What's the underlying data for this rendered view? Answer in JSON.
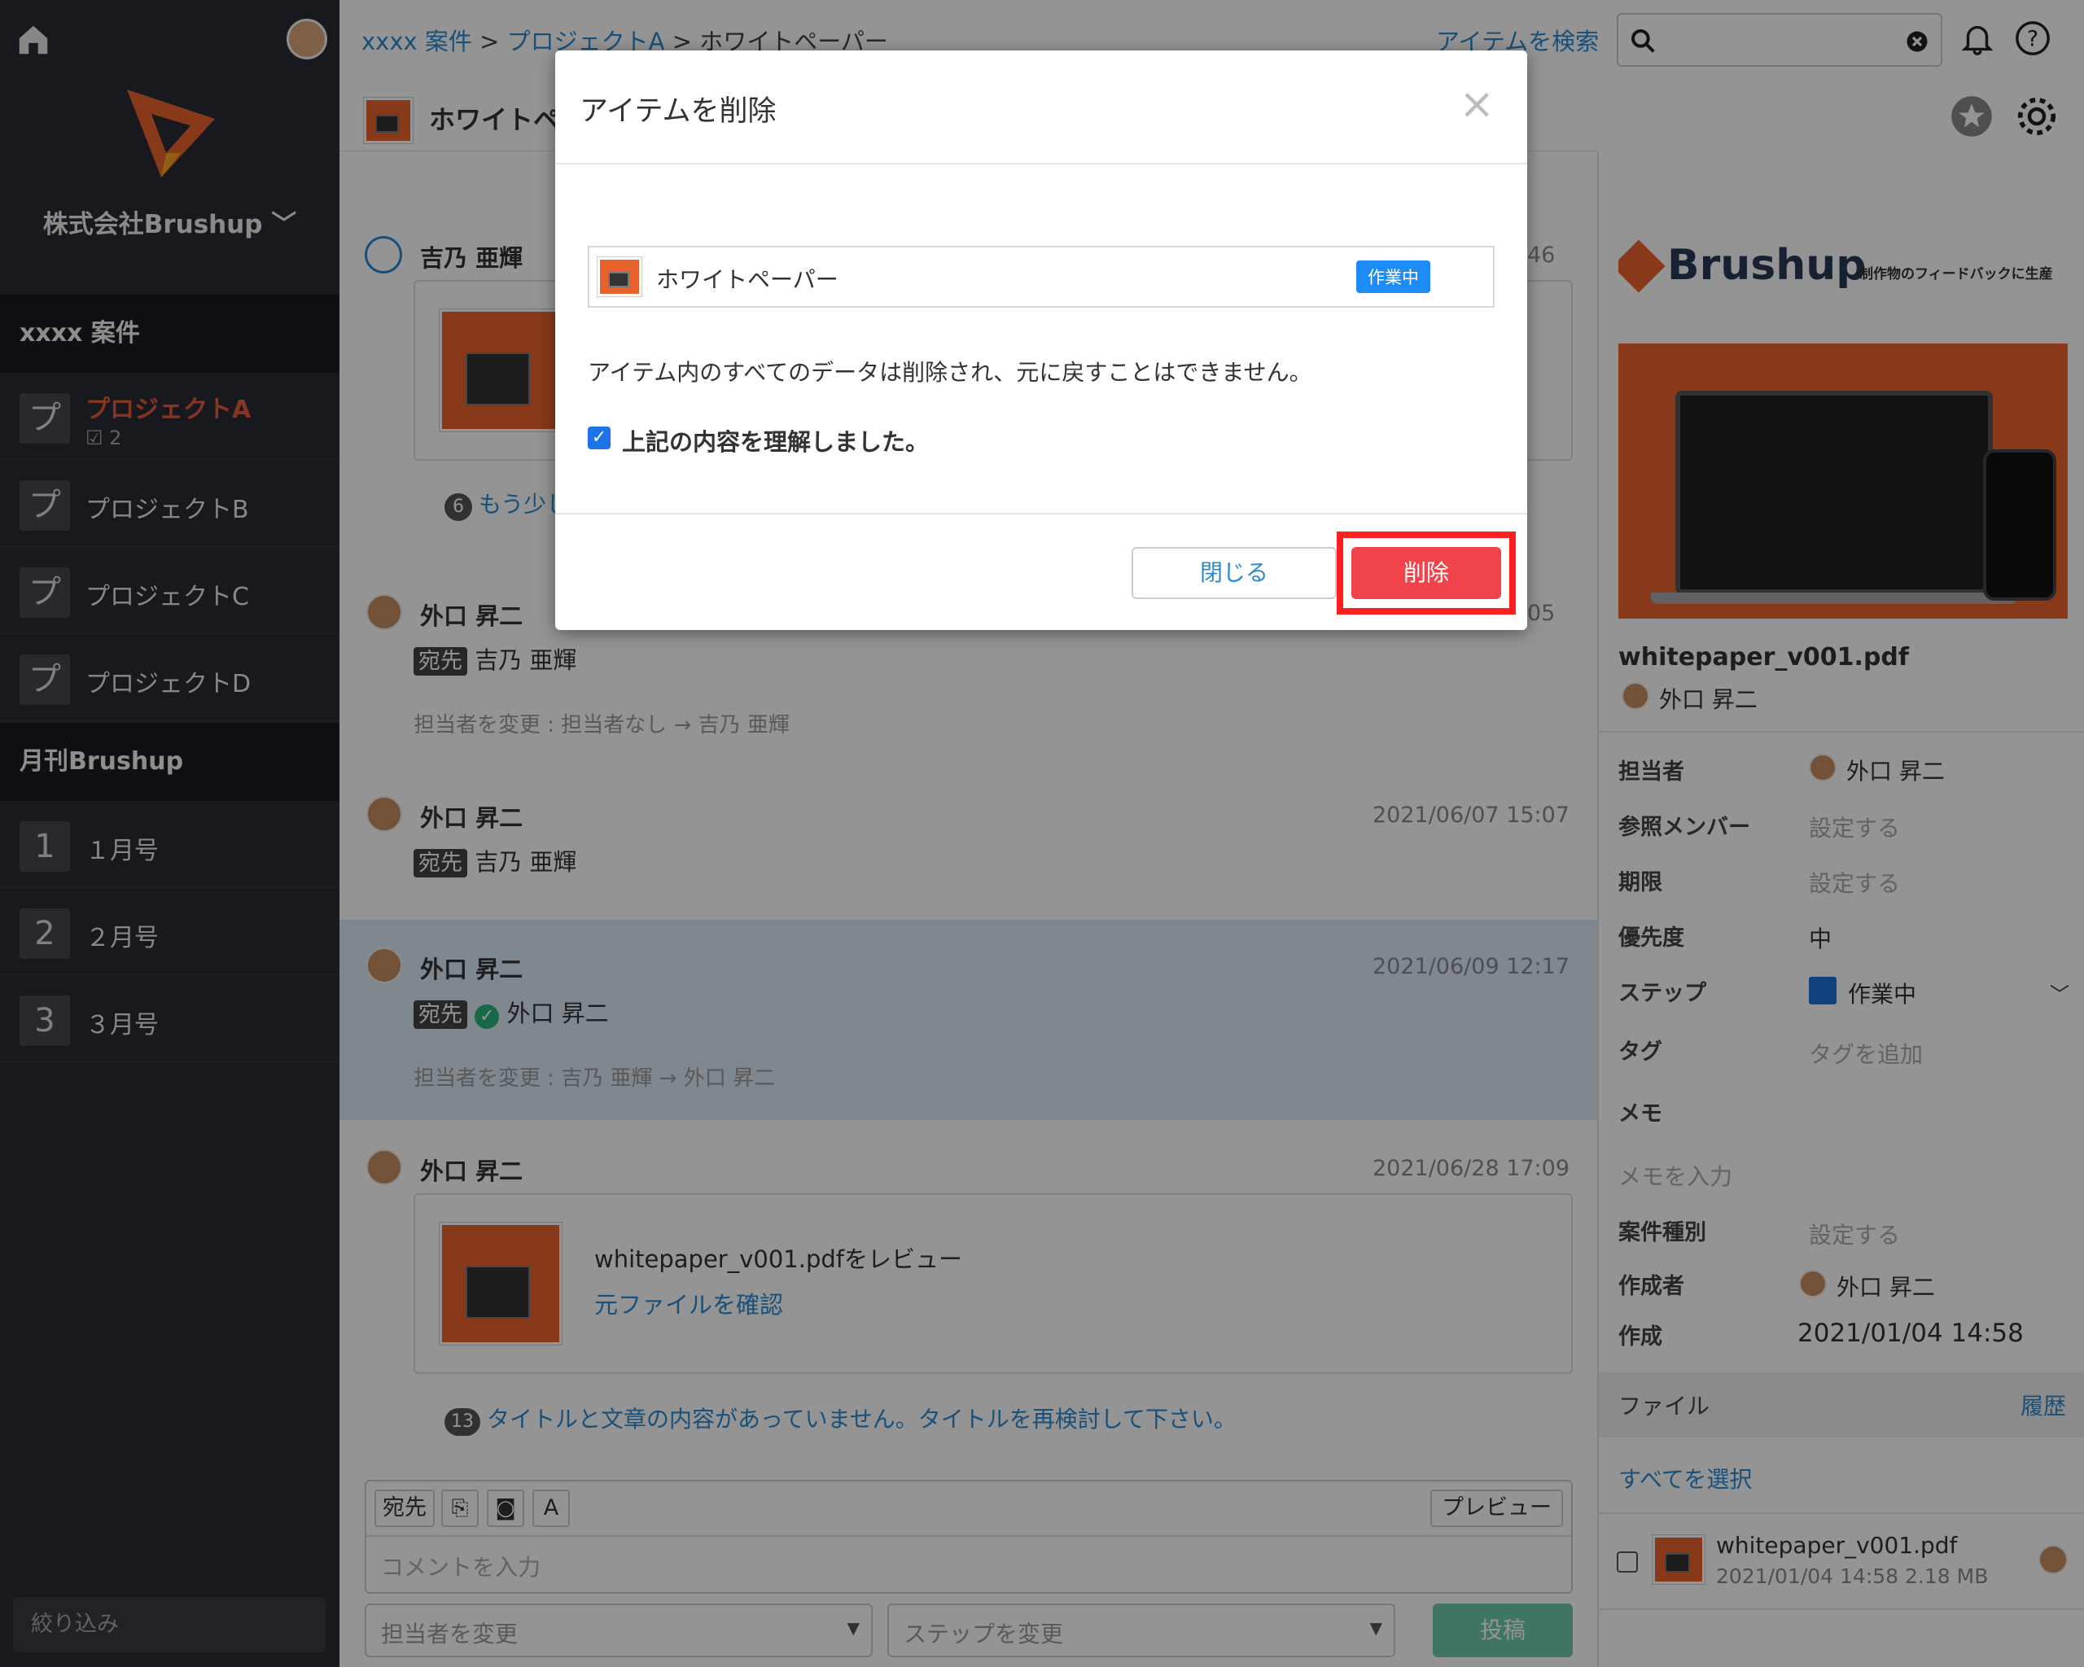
{
  "sidebar": {
    "company": "株式会社Brushup",
    "section1": "xxxx 案件",
    "projects": [
      {
        "icon": "プ",
        "label": "プロジェクトA",
        "sub": "2"
      },
      {
        "icon": "プ",
        "label": "プロジェクトB"
      },
      {
        "icon": "プ",
        "label": "プロジェクトC"
      },
      {
        "icon": "プ",
        "label": "プロジェクトD"
      }
    ],
    "section2": "月刊Brushup",
    "issues": [
      {
        "icon": "1",
        "label": "１月号"
      },
      {
        "icon": "2",
        "label": "２月号"
      },
      {
        "icon": "3",
        "label": "３月号"
      }
    ],
    "filter_placeholder": "絞り込み"
  },
  "header": {
    "crumb1": "xxxx 案件",
    "crumb2": "プロジェクトA",
    "crumb3": "ホワイトペーパー",
    "sep": ">",
    "search_link": "アイテムを検索"
  },
  "item": {
    "title": "ホワイトペ"
  },
  "feed": {
    "more_partial": "もう少し",
    "more_count": "6",
    "c0": {
      "name": "吉乃 亜輝",
      "date": "46"
    },
    "c1": {
      "name": "外口 昇二",
      "date": "05",
      "badge": "宛先",
      "to": "吉乃 亜輝",
      "change": "担当者を変更 : 担当者なし → 吉乃 亜輝"
    },
    "c2": {
      "name": "外口 昇二",
      "date": "2021/06/07 15:07",
      "badge": "宛先",
      "to": "吉乃 亜輝"
    },
    "c3": {
      "name": "外口 昇二",
      "date": "2021/06/09 12:17",
      "badge": "宛先",
      "to": "外口 昇二",
      "change": "担当者を変更 : 吉乃 亜輝 → 外口 昇二"
    },
    "c4": {
      "name": "外口 昇二",
      "date": "2021/06/28 17:09",
      "review": "whitepaper_v001.pdfをレビュー",
      "link": "元ファイルを確認",
      "thread_count": "13",
      "thread": "タイトルと文章の内容があっていません。タイトルを再検討して下さい。"
    }
  },
  "composer": {
    "to_btn": "宛先",
    "font_btn": "A",
    "preview_btn": "プレビュー",
    "placeholder": "コメントを入力",
    "assignee_select": "担当者を変更",
    "step_select": "ステップを変更",
    "post_btn": "投稿"
  },
  "right_panel": {
    "preview_brand": "Brushup",
    "preview_tagline": "制作物のフィードバックに生産",
    "file_name": "whitepaper_v001.pdf",
    "owner": "外口 昇二",
    "fields": {
      "assignee_label": "担当者",
      "assignee": "外口 昇二",
      "members_label": "参照メンバー",
      "members": "設定する",
      "due_label": "期限",
      "due": "設定する",
      "priority_label": "優先度",
      "priority": "中",
      "step_label": "ステップ",
      "step": "作業中",
      "tag_label": "タグ",
      "tag": "タグを追加",
      "memo_label": "メモ",
      "memo": "メモを入力",
      "type_label": "案件種別",
      "type": "設定する",
      "creator_label": "作成者",
      "creator": "外口 昇二",
      "created_label": "作成",
      "created": "2021/01/04 14:58"
    },
    "files_header": "ファイル",
    "history": "履歴",
    "select_all": "すべてを選択",
    "file_row": {
      "name": "whitepaper_v001.pdf",
      "meta": "2021/01/04 14:58 2.18 MB"
    }
  },
  "modal": {
    "title": "アイテムを削除",
    "close": "×",
    "item_name": "ホワイトペーパー",
    "item_status": "作業中",
    "warning": "アイテム内のすべてのデータは削除され、元に戻すことはできません。",
    "confirm": "上記の内容を理解しました。",
    "close_btn": "閉じる",
    "delete_btn": "削除"
  },
  "colors": {
    "accent": "#2c8bd0",
    "danger": "#f0434b",
    "highlight": "#ff1f1f",
    "sidebar": "#2a2c34",
    "brand": "#e8622c"
  }
}
